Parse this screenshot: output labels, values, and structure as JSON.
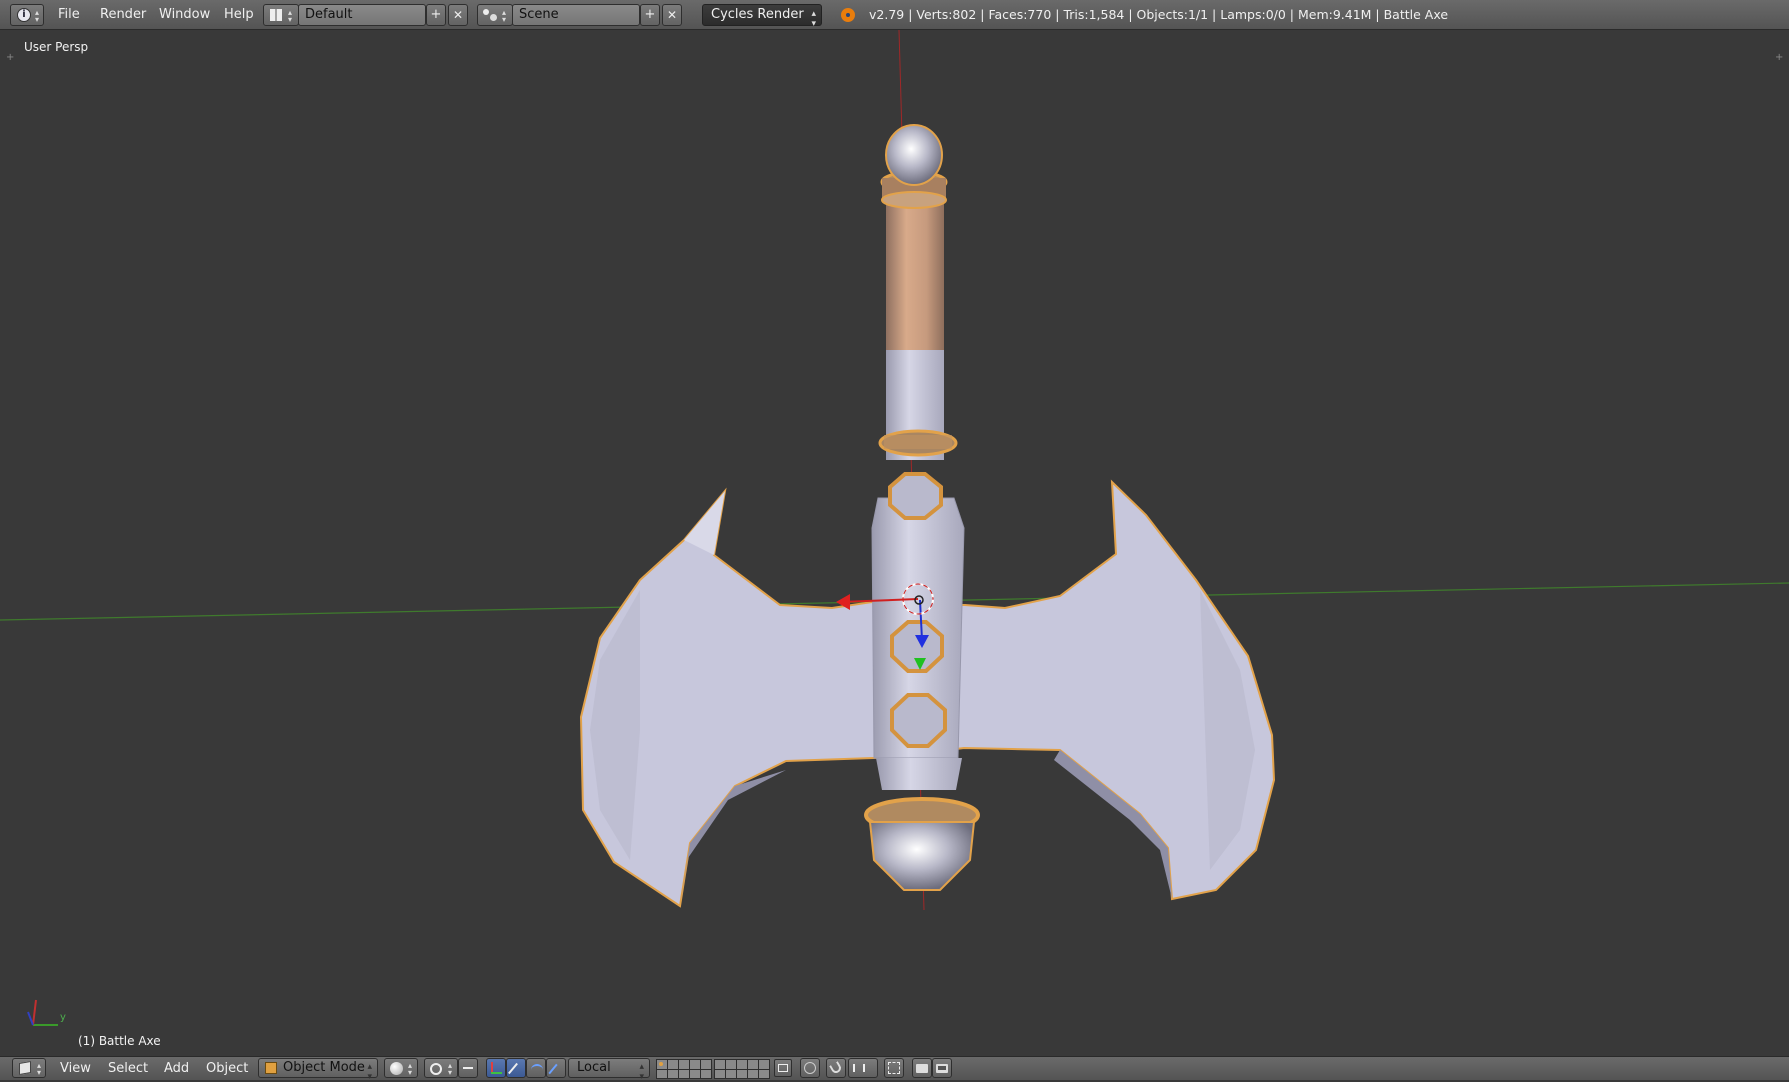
{
  "topbar": {
    "menus": [
      "File",
      "Render",
      "Window",
      "Help"
    ],
    "screen_layout": "Default",
    "scene": "Scene",
    "render_engine": "Cycles Render",
    "stats": "v2.79 | Verts:802 | Faces:770 | Tris:1,584 | Objects:1/1 | Lamps:0/0 | Mem:9.41M | Battle Axe"
  },
  "viewport": {
    "view_label": "User Persp",
    "object_label": "(1) Battle Axe",
    "axis_y": "y"
  },
  "bottombar": {
    "menus": [
      "View",
      "Select",
      "Add",
      "Object"
    ],
    "mode": "Object Mode",
    "orientation": "Local"
  },
  "colors": {
    "background": "#393939",
    "header": "#5c5c5c",
    "wood": "#c89b7b",
    "metal": "#c9c9dc",
    "selection_outline": "#e0a040",
    "x_axis": "#c43030",
    "y_axis": "#3a8a2a"
  },
  "icons": [
    "info-icon",
    "screen-layout-icon",
    "scene-icon",
    "blender-icon",
    "view3d-icon",
    "object-mode-icon",
    "viewport-shading-icon",
    "pivot-icon",
    "manipulator-icon",
    "layers-icon",
    "render-icon"
  ]
}
